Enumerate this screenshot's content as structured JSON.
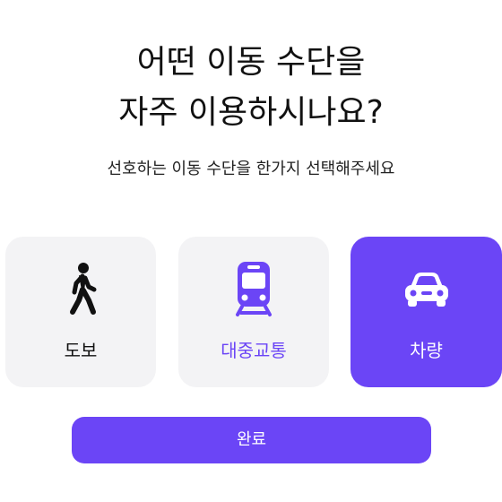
{
  "header": {
    "title_line1": "어떤 이동 수단을",
    "title_line2": "자주 이용하시나요?",
    "subtitle": "선호하는 이동 수단을 한가지 선택해주세요"
  },
  "options": [
    {
      "label": "도보",
      "icon": "walking-person-icon",
      "selected": false
    },
    {
      "label": "대중교통",
      "icon": "train-icon",
      "selected": false
    },
    {
      "label": "차량",
      "icon": "car-icon",
      "selected": true
    }
  ],
  "footer": {
    "done_label": "완료"
  },
  "colors": {
    "accent": "#6b45f6",
    "card_background": "#f3f3f5",
    "text": "#111111"
  }
}
